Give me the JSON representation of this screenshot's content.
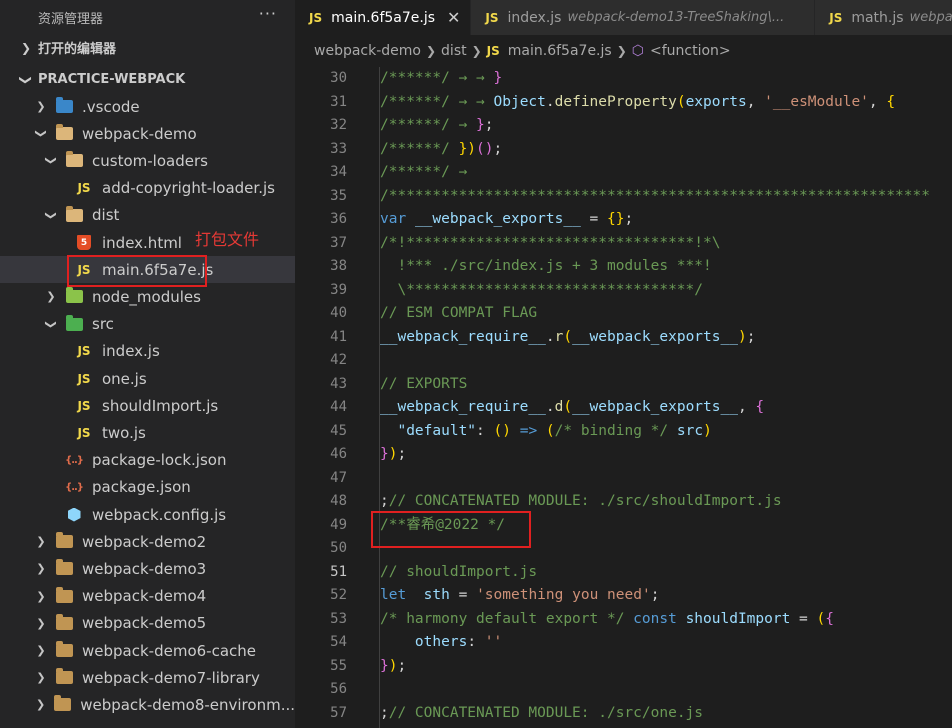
{
  "sidebar": {
    "title": "资源管理器",
    "more": "···",
    "open_editors": "打开的编辑器",
    "project": "PRACTICE-WEBPACK",
    "items": [
      {
        "label": ".vscode",
        "depth": 1,
        "icon": "vscode-folder-icon",
        "chevron": "▸"
      },
      {
        "label": "webpack-demo",
        "depth": 1,
        "icon": "folder-open-icon",
        "chevron": "▾"
      },
      {
        "label": "custom-loaders",
        "depth": 2,
        "icon": "folder-open-icon",
        "chevron": "▾"
      },
      {
        "label": "add-copyright-loader.js",
        "depth": 3,
        "icon": "js-file-icon",
        "chevron": ""
      },
      {
        "label": "dist",
        "depth": 2,
        "icon": "dist-folder-icon",
        "chevron": "▾"
      },
      {
        "label": "index.html",
        "depth": 3,
        "icon": "html-file-icon",
        "chevron": ""
      },
      {
        "label": "main.6f5a7e.js",
        "depth": 3,
        "icon": "js-file-icon",
        "chevron": "",
        "selected": true
      },
      {
        "label": "node_modules",
        "depth": 2,
        "icon": "node-modules-folder-icon",
        "chevron": "▸"
      },
      {
        "label": "src",
        "depth": 2,
        "icon": "src-folder-icon",
        "chevron": "▾"
      },
      {
        "label": "index.js",
        "depth": 3,
        "icon": "js-file-icon",
        "chevron": ""
      },
      {
        "label": "one.js",
        "depth": 3,
        "icon": "js-file-icon",
        "chevron": ""
      },
      {
        "label": "shouldImport.js",
        "depth": 3,
        "icon": "js-file-icon",
        "chevron": ""
      },
      {
        "label": "two.js",
        "depth": 3,
        "icon": "js-file-icon",
        "chevron": ""
      },
      {
        "label": "package-lock.json",
        "depth": 2,
        "icon": "json-file-icon",
        "chevron": ""
      },
      {
        "label": "package.json",
        "depth": 2,
        "icon": "json-file-icon",
        "chevron": ""
      },
      {
        "label": "webpack.config.js",
        "depth": 2,
        "icon": "webpack-config-icon",
        "chevron": ""
      },
      {
        "label": "webpack-demo2",
        "depth": 1,
        "icon": "folder-icon",
        "chevron": "▸"
      },
      {
        "label": "webpack-demo3",
        "depth": 1,
        "icon": "folder-icon",
        "chevron": "▸"
      },
      {
        "label": "webpack-demo4",
        "depth": 1,
        "icon": "folder-icon",
        "chevron": "▸"
      },
      {
        "label": "webpack-demo5",
        "depth": 1,
        "icon": "folder-icon",
        "chevron": "▸"
      },
      {
        "label": "webpack-demo6-cache",
        "depth": 1,
        "icon": "folder-icon",
        "chevron": "▸"
      },
      {
        "label": "webpack-demo7-library",
        "depth": 1,
        "icon": "folder-icon",
        "chevron": "▸"
      },
      {
        "label": "webpack-demo8-environm...",
        "depth": 1,
        "icon": "folder-icon",
        "chevron": "▸"
      }
    ],
    "annotation": "打包文件"
  },
  "tabs": [
    {
      "icon": "JS",
      "label": "main.6f5a7e.js",
      "desc": "",
      "active": true,
      "close": "✕"
    },
    {
      "icon": "JS",
      "label": "index.js",
      "desc": "webpack-demo13-TreeShaking\\...",
      "active": false,
      "close": ""
    },
    {
      "icon": "JS",
      "label": "math.js",
      "desc": "webpa",
      "active": false,
      "close": ""
    }
  ],
  "breadcrumb": {
    "parts": [
      "webpack-demo",
      "dist"
    ],
    "file_icon": "JS",
    "file": "main.6f5a7e.js",
    "symbol": "<function>"
  },
  "colors": {
    "comment": "#6a9955",
    "keyword": "#569cd6",
    "variable": "#9cdcfe",
    "function": "#dcdcaa",
    "string": "#ce9178",
    "bracket": "#ffd700",
    "bracket2": "#da70d6",
    "annotation_red": "#e53935"
  },
  "code": {
    "current_line": 51,
    "lines": [
      {
        "n": 30,
        "segs": [
          [
            "/******/ → → ",
            "comment"
          ],
          [
            "}",
            "bracket2"
          ]
        ]
      },
      {
        "n": 31,
        "segs": [
          [
            "/******/ → → ",
            "comment"
          ],
          [
            "Object",
            "variable"
          ],
          [
            ".",
            "plain"
          ],
          [
            "defineProperty",
            "function"
          ],
          [
            "(",
            "bracket"
          ],
          [
            "exports",
            "variable"
          ],
          [
            ", ",
            "plain"
          ],
          [
            "'__esModule'",
            "string"
          ],
          [
            ", ",
            "plain"
          ],
          [
            "{",
            "bracket"
          ]
        ]
      },
      {
        "n": 32,
        "segs": [
          [
            "/******/ → ",
            "comment"
          ],
          [
            "}",
            "bracket2"
          ],
          [
            ";",
            "plain"
          ]
        ]
      },
      {
        "n": 33,
        "segs": [
          [
            "/******/ ",
            "comment"
          ],
          [
            "})",
            "bracket"
          ],
          [
            "()",
            "bracket2"
          ],
          [
            ";",
            "plain"
          ]
        ]
      },
      {
        "n": 34,
        "segs": [
          [
            "/******/ →",
            "comment"
          ]
        ]
      },
      {
        "n": 35,
        "segs": [
          [
            "/**************************************************************",
            "comment"
          ]
        ]
      },
      {
        "n": 36,
        "segs": [
          [
            "var",
            "keyword"
          ],
          [
            " ",
            "plain"
          ],
          [
            "__webpack_exports__",
            "variable"
          ],
          [
            " = ",
            "plain"
          ],
          [
            "{}",
            "bracket"
          ],
          [
            ";",
            "plain"
          ]
        ]
      },
      {
        "n": 37,
        "segs": [
          [
            "/*!*********************************!*\\",
            "comment"
          ]
        ]
      },
      {
        "n": 38,
        "segs": [
          [
            "  !*** ./src/index.js + 3 modules ***!",
            "comment"
          ]
        ]
      },
      {
        "n": 39,
        "segs": [
          [
            "  \\*********************************/",
            "comment"
          ]
        ]
      },
      {
        "n": 40,
        "segs": [
          [
            "// ESM COMPAT FLAG",
            "comment"
          ]
        ]
      },
      {
        "n": 41,
        "segs": [
          [
            "__webpack_require__",
            "variable"
          ],
          [
            ".",
            "plain"
          ],
          [
            "r",
            "function"
          ],
          [
            "(",
            "bracket"
          ],
          [
            "__webpack_exports__",
            "variable"
          ],
          [
            ")",
            "bracket"
          ],
          [
            ";",
            "plain"
          ]
        ]
      },
      {
        "n": 42,
        "segs": []
      },
      {
        "n": 43,
        "segs": [
          [
            "// EXPORTS",
            "comment"
          ]
        ]
      },
      {
        "n": 44,
        "segs": [
          [
            "__webpack_require__",
            "variable"
          ],
          [
            ".",
            "plain"
          ],
          [
            "d",
            "function"
          ],
          [
            "(",
            "bracket"
          ],
          [
            "__webpack_exports__",
            "variable"
          ],
          [
            ", ",
            "plain"
          ],
          [
            "{",
            "bracket2"
          ]
        ]
      },
      {
        "n": 45,
        "segs": [
          [
            "  ",
            "plain"
          ],
          [
            "\"default\"",
            "variable"
          ],
          [
            ": ",
            "plain"
          ],
          [
            "()",
            "bracket"
          ],
          [
            " => ",
            "keyword"
          ],
          [
            "(",
            "bracket"
          ],
          [
            "/* binding */",
            "comment"
          ],
          [
            " src",
            "variable"
          ],
          [
            ")",
            "bracket"
          ]
        ]
      },
      {
        "n": 46,
        "segs": [
          [
            "}",
            "bracket2"
          ],
          [
            ")",
            "bracket"
          ],
          [
            ";",
            "plain"
          ]
        ]
      },
      {
        "n": 47,
        "segs": []
      },
      {
        "n": 48,
        "segs": [
          [
            ";",
            "plain"
          ],
          [
            "// CONCATENATED MODULE: ./src/shouldImport.js",
            "comment"
          ]
        ]
      },
      {
        "n": 49,
        "segs": [
          [
            "/**睿希@2022 */",
            "comment"
          ]
        ]
      },
      {
        "n": 50,
        "segs": []
      },
      {
        "n": 51,
        "segs": [
          [
            "// shouldImport.js",
            "comment"
          ]
        ]
      },
      {
        "n": 52,
        "segs": [
          [
            "let",
            "keyword"
          ],
          [
            "  ",
            "plain"
          ],
          [
            "sth",
            "variable"
          ],
          [
            " = ",
            "plain"
          ],
          [
            "'something you need'",
            "string"
          ],
          [
            ";",
            "plain"
          ]
        ]
      },
      {
        "n": 53,
        "segs": [
          [
            "/* harmony default export */",
            "comment"
          ],
          [
            " ",
            "plain"
          ],
          [
            "const",
            "keyword"
          ],
          [
            " ",
            "plain"
          ],
          [
            "shouldImport",
            "variable"
          ],
          [
            " = ",
            "plain"
          ],
          [
            "(",
            "bracket"
          ],
          [
            "{",
            "bracket2"
          ]
        ]
      },
      {
        "n": 54,
        "segs": [
          [
            "    ",
            "plain"
          ],
          [
            "others",
            "variable"
          ],
          [
            ": ",
            "plain"
          ],
          [
            "''",
            "string"
          ]
        ]
      },
      {
        "n": 55,
        "segs": [
          [
            "}",
            "bracket2"
          ],
          [
            ")",
            "bracket"
          ],
          [
            ";",
            "plain"
          ]
        ]
      },
      {
        "n": 56,
        "segs": []
      },
      {
        "n": 57,
        "segs": [
          [
            ";",
            "plain"
          ],
          [
            "// CONCATENATED MODULE: ./src/one.js",
            "comment"
          ]
        ]
      }
    ]
  }
}
